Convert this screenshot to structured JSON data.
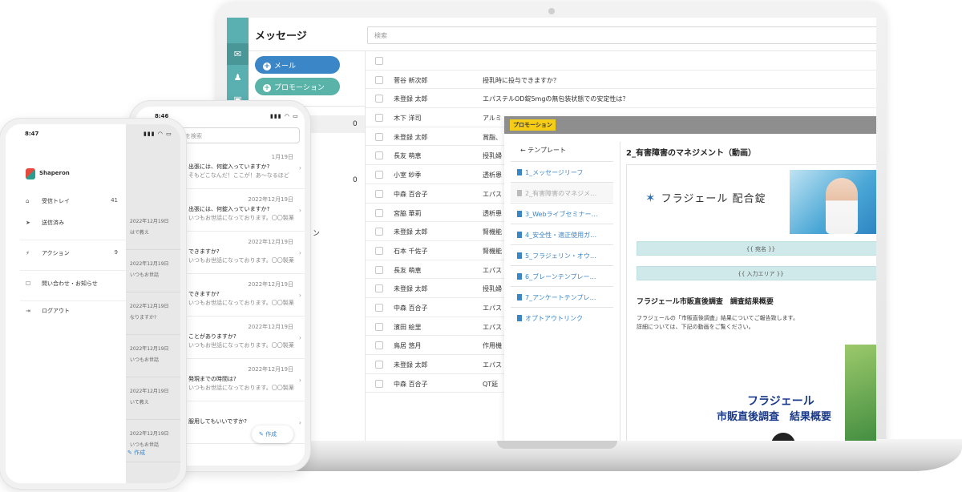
{
  "laptop": {
    "title": "メッセージ",
    "search_placeholder": "検索",
    "mail_button": "メール",
    "promotion_button": "プロモーション",
    "folder_counts": [
      "0",
      "0"
    ],
    "folder_partial_label": "ョン",
    "messages": [
      {
        "name": "菅谷 新次郎",
        "subject": "授乳時に投与できますか？"
      },
      {
        "name": "未登録 太郎",
        "subject": "エパステルOD錠5mgの無包装状態での安定性は？"
      },
      {
        "name": "木下 洋司",
        "subject": "アルミ"
      },
      {
        "name": "未登録 太郎",
        "subject": "賞脂、"
      },
      {
        "name": "長友 萌恵",
        "subject": "授乳婦"
      },
      {
        "name": "小室 紗季",
        "subject": "透析患"
      },
      {
        "name": "中森 百合子",
        "subject": "エパス"
      },
      {
        "name": "宮脇 華莉",
        "subject": "透析患"
      },
      {
        "name": "未登録 太郎",
        "subject": "腎機能"
      },
      {
        "name": "石本 千佐子",
        "subject": "腎機能"
      },
      {
        "name": "長友 萌恵",
        "subject": "エパス"
      },
      {
        "name": "未登録 太郎",
        "subject": "授乳婦"
      },
      {
        "name": "中森 百合子",
        "subject": "エパス"
      },
      {
        "name": "濱田 絵里",
        "subject": "エパス"
      },
      {
        "name": "鳥居 悠月",
        "subject": "作用機"
      },
      {
        "name": "未登録 太郎",
        "subject": "エパス"
      },
      {
        "name": "中森 百合子",
        "subject": "QT延"
      }
    ]
  },
  "popup": {
    "tag": "プロモーション",
    "back_label": "← テンプレート",
    "templates": [
      "1_メッセージリーフ",
      "2_有害障害のマネジメ…",
      "3_Webライブセミナー…",
      "4_安全性・適正使用ガ…",
      "5_フラジェリン・オウ…",
      "6_ブレーンテンプレー…",
      "7_アンケートテンプレ…",
      "オプトアウトリンク"
    ],
    "content_title": "2_有害障害のマネジメント（動画）",
    "brand": "フラジェール 配合錠",
    "placeholder_name": "{{ 宛名 }}",
    "placeholder_input": "{{ 入力エリア }}",
    "heading": "フラジェール市販直後調査　調査結果概要",
    "body_line1": "フラジェールの「市販直後調査」結果についてご報告致します。",
    "body_line2": "詳細については、下記の動画をご覧ください。",
    "video_title1": "フラジェール",
    "video_title2": "市販直後調査　結果概要"
  },
  "phone_back": {
    "time": "8:46",
    "status_icons": "▮▮▮ ◠ ▭",
    "search_placeholder": "を検索",
    "rows": [
      {
        "date": "1月19日",
        "line1": "出張には、何錠入っていますか?",
        "line2": "そもどこなんだ！ここが！あ～なるほど"
      },
      {
        "date": "2022年12月19日",
        "line1": "出張には、何錠入っていますか?",
        "line2": "いつもお世話になっております。〇〇製薬"
      },
      {
        "date": "2022年12月19日",
        "line1": "できますか?",
        "line2": "いつもお世話になっております。〇〇製薬"
      },
      {
        "date": "2022年12月19日",
        "line1": "できますか?",
        "line2": "いつもお世話になっております。〇〇製薬"
      },
      {
        "date": "2022年12月19日",
        "line1": "ことがありますか?",
        "line2": "いつもお世話になっております。〇〇製薬"
      },
      {
        "date": "2022年12月19日",
        "line1": "発現までの時間は?",
        "line2": "いつもお世話になっております。〇〇製薬"
      },
      {
        "date": "",
        "line1": "服用してもいいですか?",
        "line2": ""
      }
    ],
    "create_label": "作成"
  },
  "phone_front": {
    "time": "8:47",
    "status_icons": "▮▮▮ ◠ ▭",
    "logo_text": "Shaperon",
    "menu": [
      {
        "icon": "⌂",
        "label": "受信トレイ",
        "count": "41"
      },
      {
        "icon": "➤",
        "label": "送信済み",
        "count": ""
      },
      {
        "icon": "⚡",
        "label": "アクション",
        "count": "9"
      },
      {
        "icon": "☐",
        "label": "問い合わせ・お知らせ",
        "count": ""
      },
      {
        "icon": "⇥",
        "label": "ログアウト",
        "count": ""
      }
    ],
    "shade_dates": [
      "2022年12月19日",
      "2022年12月19日",
      "2022年12月19日",
      "2022年12月19日",
      "2022年12月19日",
      "2022年12月19日"
    ],
    "shade_snippets": [
      "はで教え",
      "いつもお世話",
      "なりますか?",
      "いつもお世話",
      "いて教え",
      "いつもお世話"
    ],
    "create_label": "作成"
  }
}
